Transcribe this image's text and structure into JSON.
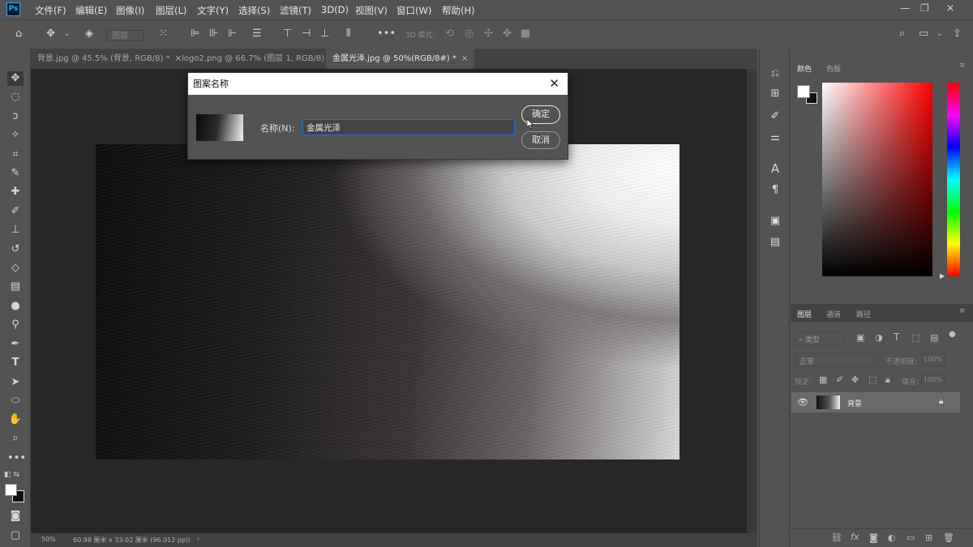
{
  "app": {
    "logo_text": "Ps"
  },
  "menu": [
    "文件(F)",
    "编辑(E)",
    "图像(I)",
    "图层(L)",
    "文字(Y)",
    "选择(S)",
    "滤镜(T)",
    "3D(D)",
    "视图(V)",
    "窗口(W)",
    "帮助(H)"
  ],
  "options_bar": {
    "layer_select": "图层",
    "mode_3d": "3D 模式:"
  },
  "tabs": [
    {
      "label": "背景.jpg @ 45.5% (背景, RGB/8) *"
    },
    {
      "label": "logo2.png @ 66.7% (图层 1, RGB/8)"
    },
    {
      "label": "金属光泽.jpg @ 50%(RGB/8#) *"
    }
  ],
  "status": {
    "zoom": "50%",
    "doc_info": "60.98 厘米 x 33.02 厘米 (96.012 ppi)"
  },
  "panels": {
    "color_tabs": [
      "颜色",
      "色板"
    ],
    "layers_tabs": [
      "图层",
      "通道",
      "路径"
    ],
    "filter_kind": "类型",
    "blend_mode": "正常",
    "opacity_label": "不透明度:",
    "opacity_value": "100%",
    "lock_label": "锁定:",
    "fill_label": "填充:",
    "fill_value": "100%",
    "layer_name": "背景"
  },
  "dialog": {
    "title": "图案名称",
    "name_label": "名称(N):",
    "name_value": "金属光泽",
    "ok_label": "确定",
    "cancel_label": "取消"
  },
  "colors": {
    "accent": "#1473e6",
    "ui_bg": "#535353",
    "workspace": "#282828"
  }
}
